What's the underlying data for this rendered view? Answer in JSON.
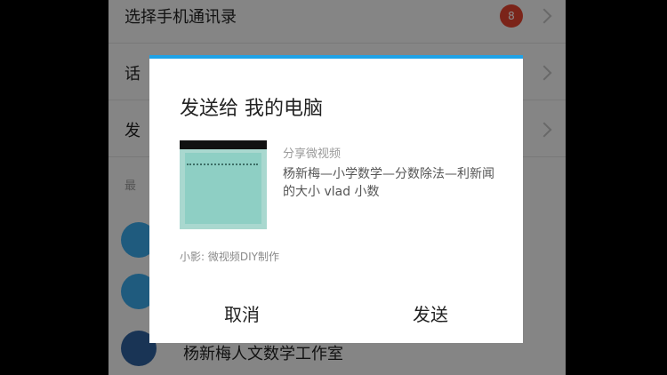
{
  "background_list": {
    "rows": [
      {
        "label": "选择手机通讯录",
        "badge": "8"
      },
      {
        "label": "话"
      },
      {
        "label": "发"
      }
    ],
    "section_header": "最",
    "contacts": [
      {
        "name": ""
      },
      {
        "name": ""
      },
      {
        "name": "杨新梅人文数学工作室"
      }
    ]
  },
  "dialog": {
    "title": "发送给 我的电脑",
    "share_label": "分享微视频",
    "share_description": "杨新梅—小学数学—分数除法—利新闻的大小 vlad 小数",
    "source": "小影: 微视频DIY制作",
    "cancel_label": "取消",
    "send_label": "发送"
  },
  "colors": {
    "accent": "#1fa2e6",
    "badge": "#e0432f",
    "overlay": "rgba(0,0,0,0.45)"
  }
}
